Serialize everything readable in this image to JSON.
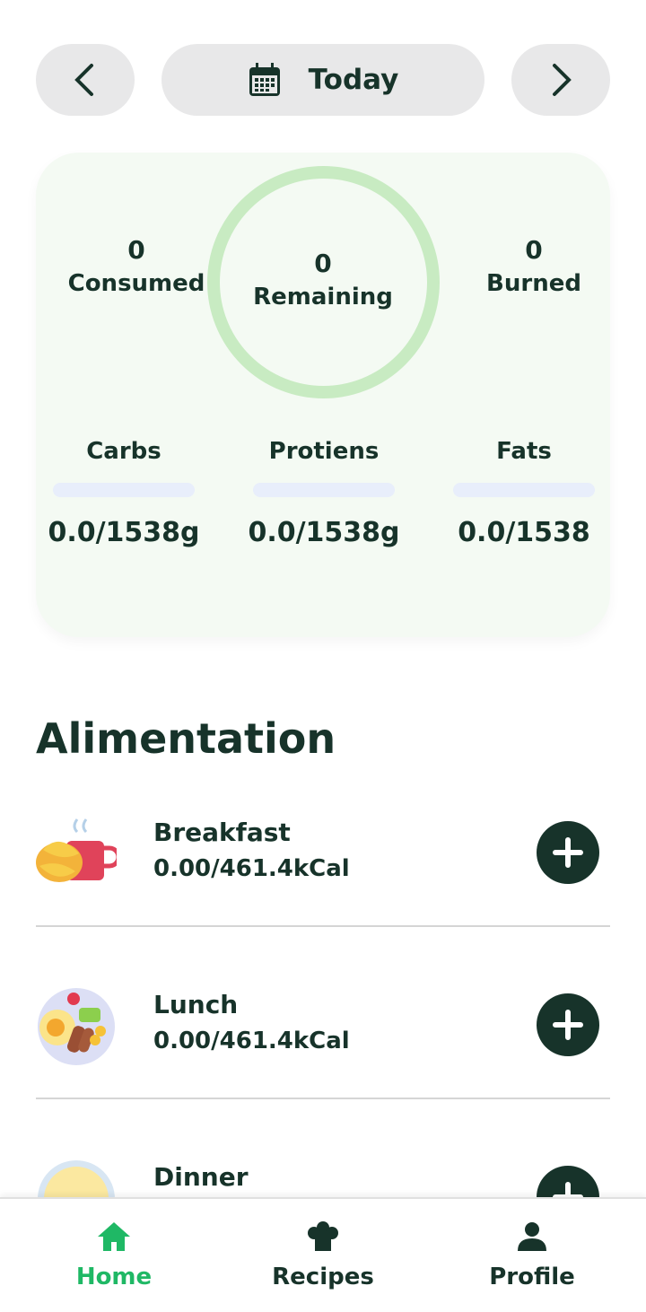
{
  "header": {
    "prev_icon": "chevron-left-icon",
    "next_icon": "chevron-right-icon",
    "date_icon": "calendar-icon",
    "date_label": "Today"
  },
  "summary": {
    "consumed": {
      "value": "0",
      "label": "Consumed"
    },
    "remaining": {
      "value": "0",
      "label": "Remaining"
    },
    "burned": {
      "value": "0",
      "label": "Burned"
    },
    "ring_color": "#c8ebc2",
    "macros": [
      {
        "label": "Carbs",
        "value": "0.0/1538g",
        "progress": 0
      },
      {
        "label": "Protiens",
        "value": "0.0/1538g",
        "progress": 0
      },
      {
        "label": "Fats",
        "value": "0.0/1538",
        "progress": 0
      }
    ]
  },
  "alimentation": {
    "title": "Alimentation",
    "meals": [
      {
        "name": "Breakfast",
        "kcal": "0.00/461.4kCal",
        "icon": "croissant-coffee-icon"
      },
      {
        "name": "Lunch",
        "kcal": "0.00/461.4kCal",
        "icon": "lunch-plate-icon"
      },
      {
        "name": "Dinner",
        "kcal": "",
        "icon": "dinner-plate-icon"
      }
    ]
  },
  "nav": {
    "items": [
      {
        "label": "Home",
        "icon": "home-icon",
        "active": true
      },
      {
        "label": "Recipes",
        "icon": "chef-hat-icon",
        "active": false
      },
      {
        "label": "Profile",
        "icon": "user-icon",
        "active": false
      }
    ],
    "active_color": "#1fb865"
  },
  "colors": {
    "primary_dark": "#17332a",
    "card_bg": "#f4faf3"
  }
}
